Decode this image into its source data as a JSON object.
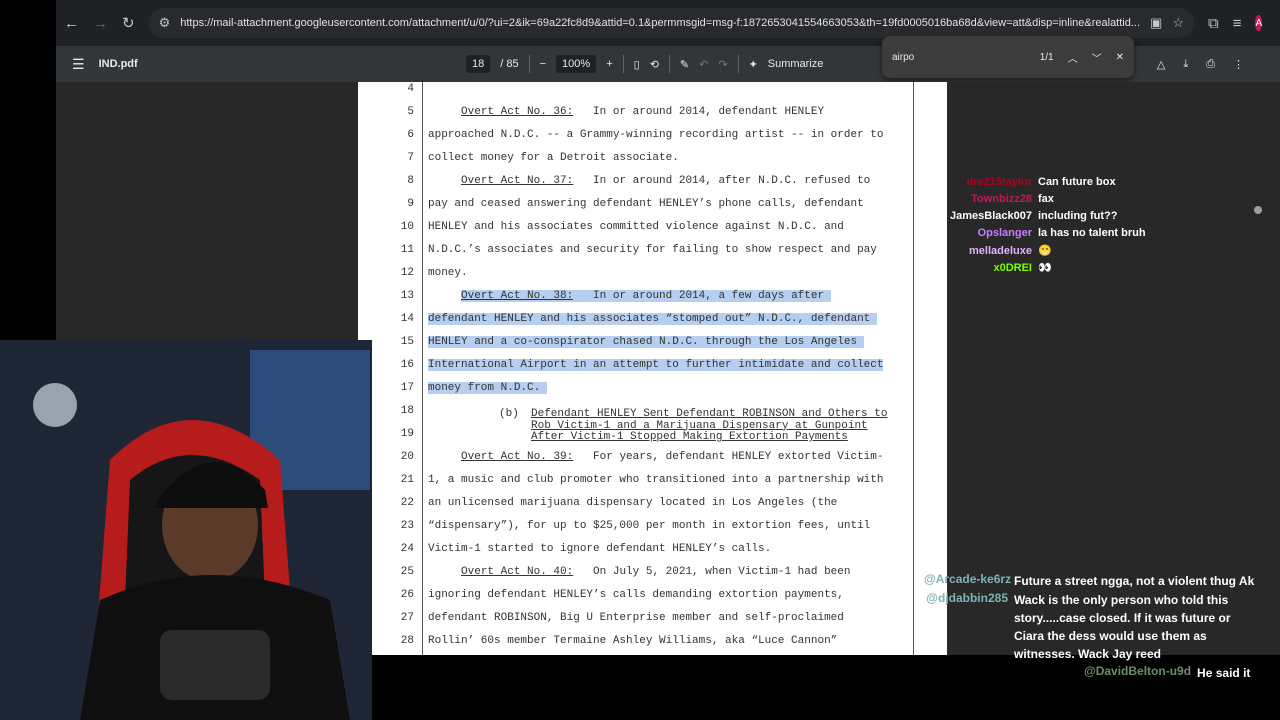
{
  "browser": {
    "url": "https://mail-attachment.googleusercontent.com/attachment/u/0/?ui=2&ik=69a22fc8d9&attid=0.1&permmsgid=msg-f:1872653041554663053&th=19fd0005016ba68d&view=att&disp=inline&realattid...",
    "avatar_letter": "A"
  },
  "pdf": {
    "filename": "IND.pdf",
    "page_current": "18",
    "page_total": "/ 85",
    "zoom": "100%",
    "summarize": "Summarize"
  },
  "find": {
    "query": "airpo",
    "count": "1/1"
  },
  "document": {
    "lines": [
      {
        "n": "4",
        "t": ""
      },
      {
        "n": "5",
        "t": "     Overt Act No. 36:   In or around 2014, defendant HENLEY"
      },
      {
        "n": "6",
        "t": "approached N.D.C. -- a Grammy-winning recording artist -- in order to"
      },
      {
        "n": "7",
        "t": "collect money for a Detroit associate."
      },
      {
        "n": "8",
        "t": "     Overt Act No. 37:   In or around 2014, after N.D.C. refused to"
      },
      {
        "n": "9",
        "t": "pay and ceased answering defendant HENLEY’s phone calls, defendant"
      },
      {
        "n": "10",
        "t": "HENLEY and his associates committed violence against N.D.C. and"
      },
      {
        "n": "11",
        "t": "N.D.C.’s associates and security for failing to show respect and pay"
      },
      {
        "n": "12",
        "t": "money."
      },
      {
        "n": "13",
        "t": "     Overt Act No. 38:   In or around 2014, a few days after "
      },
      {
        "n": "14",
        "t": "defendant HENLEY and his associates “stomped out” N.D.C., defendant "
      },
      {
        "n": "15",
        "t": "HENLEY and a co-conspirator chased N.D.C. through the Los Angeles "
      },
      {
        "n": "16",
        "t": "International Airport in an attempt to further intimidate and collect"
      },
      {
        "n": "17",
        "t": "money from N.D.C. "
      },
      {
        "n": "18",
        "t": ""
      },
      {
        "n": "19",
        "t": ""
      },
      {
        "n": "20",
        "t": "     Overt Act No. 39:   For years, defendant HENLEY extorted Victim-"
      },
      {
        "n": "21",
        "t": "1, a music and club promoter who transitioned into a partnership with"
      },
      {
        "n": "22",
        "t": "an unlicensed marijuana dispensary located in Los Angeles (the"
      },
      {
        "n": "23",
        "t": "“dispensary”), for up to $25,000 per month in extortion fees, until"
      },
      {
        "n": "24",
        "t": "Victim-1 started to ignore defendant HENLEY’s calls."
      },
      {
        "n": "25",
        "t": "     Overt Act No. 40:   On July 5, 2021, when Victim-1 had been"
      },
      {
        "n": "26",
        "t": "ignoring defendant HENLEY’s calls demanding extortion payments,"
      },
      {
        "n": "27",
        "t": "defendant ROBINSON, Big U Enterprise member and self-proclaimed"
      },
      {
        "n": "28",
        "t": "Rollin’ 60s member Termaine Ashley Williams, aka “Luce Cannon”"
      }
    ],
    "subhead_marker": "(b)",
    "subhead": "Defendant HENLEY Sent Defendant ROBINSON and Others to\nRob Victim-1 and a Marijuana Dispensary at Gunpoint\nAfter Victim-1 Stopped Making Extortion Payments"
  },
  "chat": [
    {
      "user": "dre215taylor",
      "color": "#b00020",
      "msg": "Can future box"
    },
    {
      "user": "Townbizz28",
      "color": "#c2185b",
      "msg": "fax"
    },
    {
      "user": "JamesBlack007",
      "color": "#ffffff",
      "msg": "including fut??"
    },
    {
      "user": "Opslanger",
      "color": "#c77dff",
      "msg": "la has no talent bruh"
    },
    {
      "user": "melladeluxe",
      "color": "#e0b3ff",
      "msg": "😁"
    },
    {
      "user": "x0DREI",
      "color": "#7cfc00",
      "msg": "👀"
    }
  ],
  "chat_bottom": [
    {
      "user": "@Arcade-ke6rz",
      "color": "#7fb3b3",
      "msg": "Future a street ngga, not a violent thug Ak"
    },
    {
      "user": "@djdabbin285",
      "color": "#7fb3b3",
      "msg": "Wack is the only person who told this story.....case closed. If it was future or Ciara the dess would use them as witnesses. Wack Jay reed"
    },
    {
      "user": "@DavidBelton-u9d",
      "color": "#6b8e6b",
      "msg": "He said it"
    }
  ]
}
